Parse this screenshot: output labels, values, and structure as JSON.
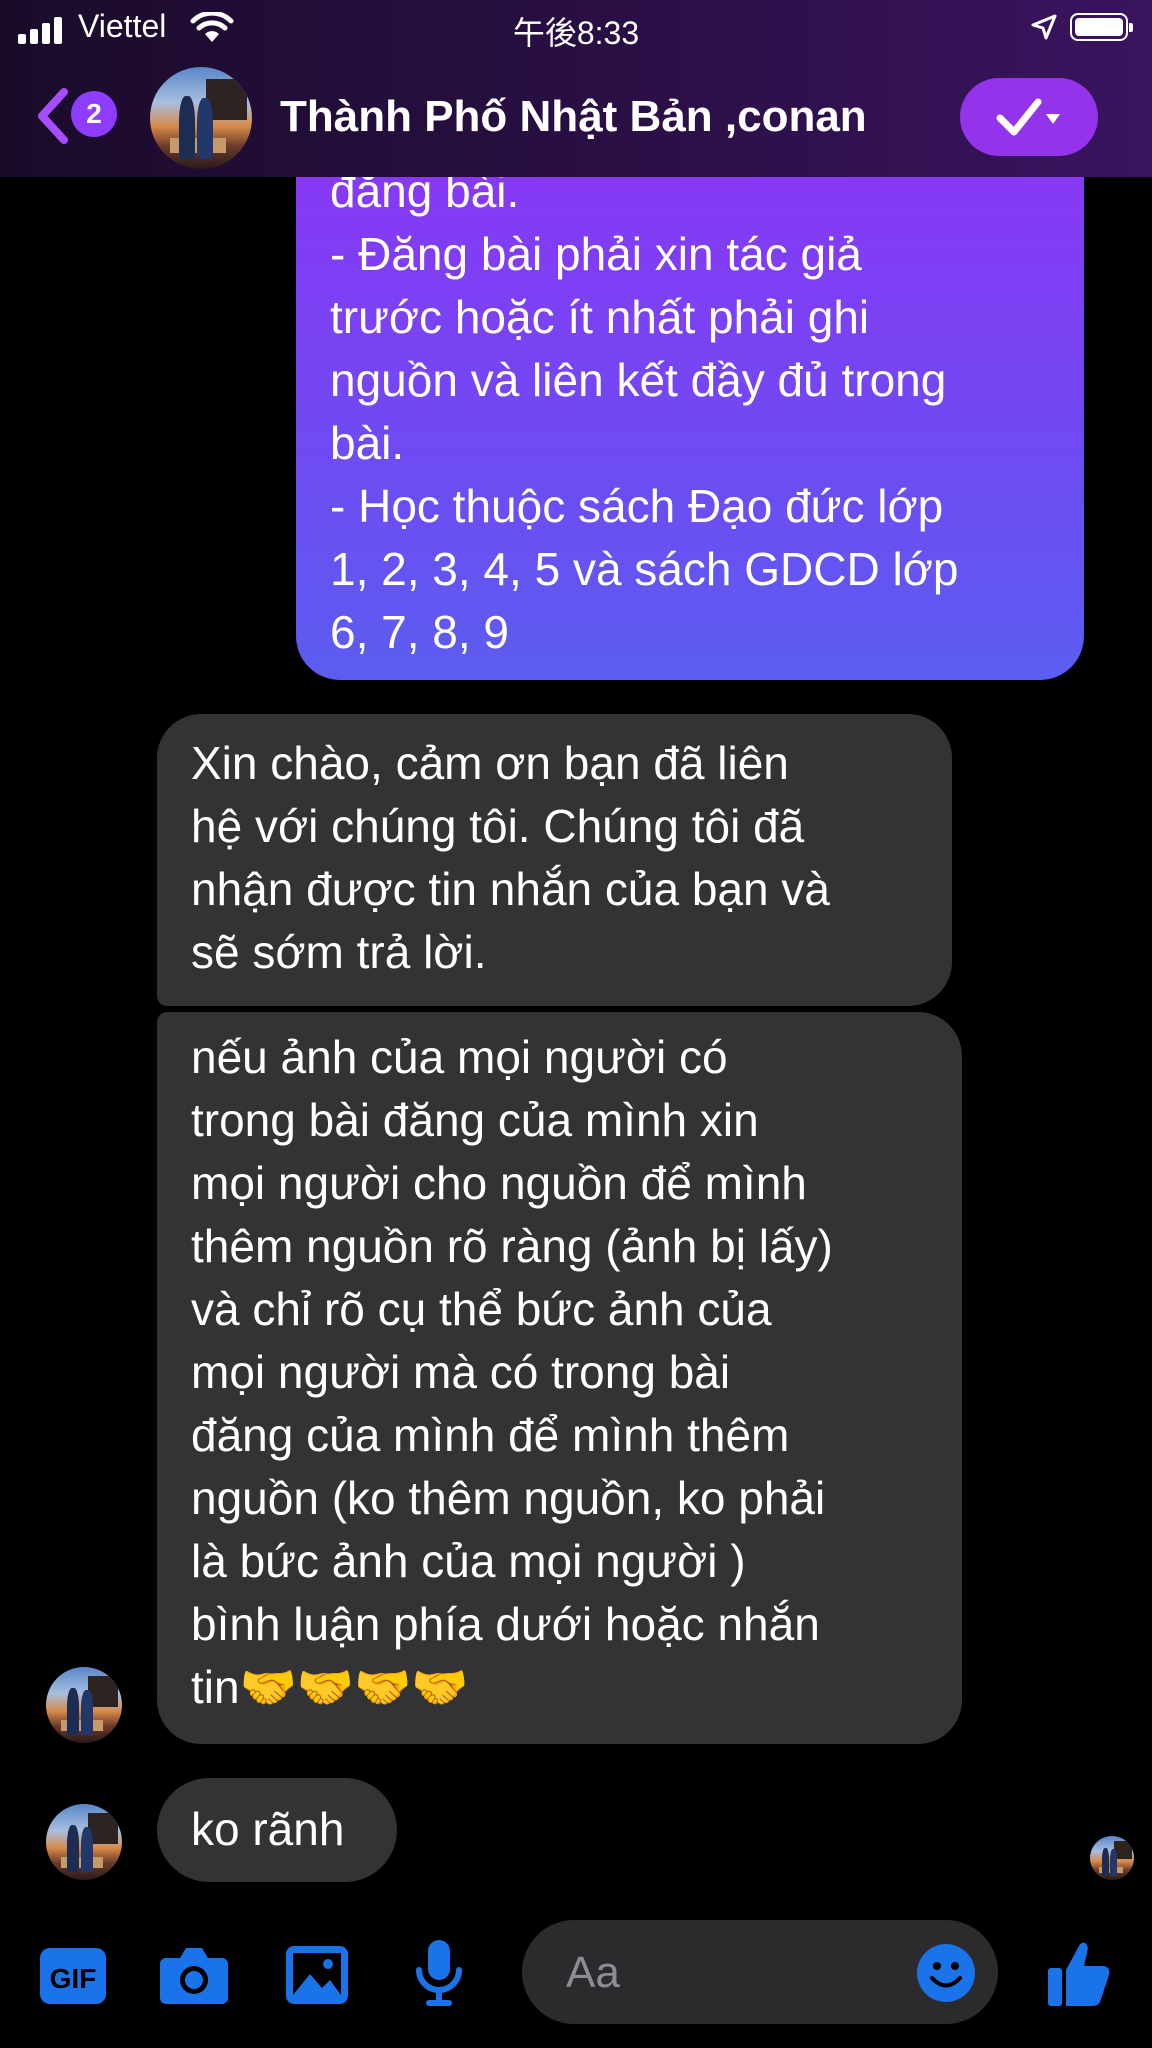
{
  "status_bar": {
    "carrier": "Viettel",
    "time": "午後8:33"
  },
  "header": {
    "unread_count": "2",
    "conversation_title": "Thành Phố Nhật Bản ,conan"
  },
  "messages": [
    {
      "direction": "outgoing",
      "text": "đăng bài.\n- Đăng bài phải xin tác giả\ntrước hoặc ít nhất phải ghi\nnguồn và liên kết đầy đủ trong\nbài.\n- Học thuộc sách Đạo đức lớp\n1, 2, 3, 4, 5 và sách GDCD lớp\n6, 7, 8, 9"
    },
    {
      "direction": "incoming",
      "text": "Xin chào, cảm ơn bạn đã liên\nhệ với chúng tôi. Chúng tôi đã\nnhận được tin nhắn của bạn và\nsẽ sớm trả lời."
    },
    {
      "direction": "incoming",
      "text": "nếu ảnh của mọi người có\ntrong bài đăng của mình xin\nmọi người cho nguồn để mình\nthêm nguồn rõ ràng (ảnh bị lấy)\nvà chỉ rõ cụ thể bức ảnh của\nmọi người mà có trong bài\nđăng của mình để mình thêm\nnguồn (ko thêm nguồn, ko phải\nlà bức ảnh của mọi người )\nbình luận phía dưới hoặc nhắn\ntin🤝🤝🤝🤝"
    },
    {
      "direction": "incoming",
      "text": "ko rãnh"
    }
  ],
  "composer": {
    "placeholder": "Aa",
    "gif_label": "GIF"
  },
  "colors": {
    "outgoing_bubble_top": "#8b36f5",
    "outgoing_bubble_bottom": "#5b5df0",
    "incoming_bubble": "#333335",
    "accent_blue": "#1a73e8",
    "badge": "#8e3cff"
  },
  "icons": {
    "back": "chevron-left-icon",
    "check": "check-dropdown-icon",
    "gif": "gif-icon",
    "camera": "camera-icon",
    "image": "image-icon",
    "mic": "microphone-icon",
    "emoji": "emoji-icon",
    "like": "thumbs-up-icon"
  }
}
